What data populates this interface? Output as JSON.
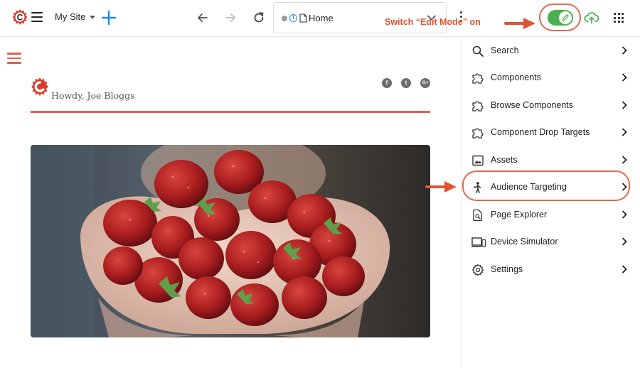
{
  "toolbar": {
    "site_name": "My Site",
    "address": "Home",
    "accent": "#1e88e5",
    "toggle_color": "#4caf50",
    "edit_mode_on": true
  },
  "annotations": {
    "edit_mode": "Switch “Edit Mode” on",
    "color": "#e2532f"
  },
  "page": {
    "greeting": "Howdy, Joe Bloggs",
    "brand_color": "#e06050",
    "social": [
      {
        "icon": "facebook-icon",
        "glyph": "f"
      },
      {
        "icon": "twitter-icon",
        "glyph": "t"
      },
      {
        "icon": "google-plus-icon",
        "glyph": "G+"
      }
    ]
  },
  "panel": {
    "items": [
      {
        "label": "Search",
        "icon": "search-icon"
      },
      {
        "label": "Components",
        "icon": "puzzle-icon"
      },
      {
        "label": "Browse Components",
        "icon": "puzzle-icon"
      },
      {
        "label": "Component Drop Targets",
        "icon": "puzzle-icon"
      },
      {
        "label": "Assets",
        "icon": "image-icon"
      },
      {
        "label": "Audience Targeting",
        "icon": "person-icon"
      },
      {
        "label": "Page Explorer",
        "icon": "page-search-icon"
      },
      {
        "label": "Device Simulator",
        "icon": "devices-icon"
      },
      {
        "label": "Settings",
        "icon": "gear-icon"
      }
    ]
  }
}
